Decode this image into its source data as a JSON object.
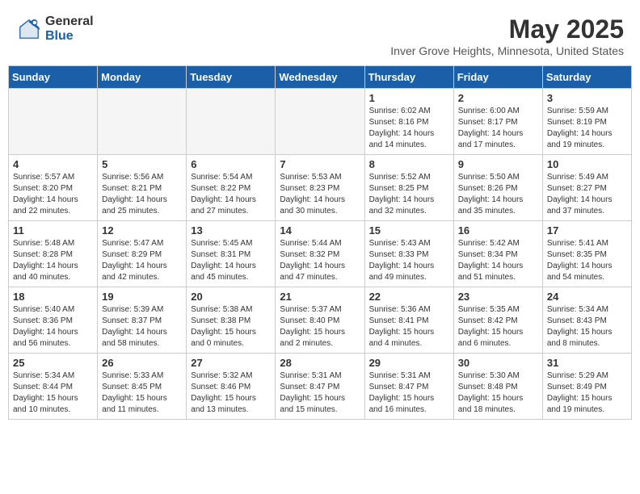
{
  "logo": {
    "general": "General",
    "blue": "Blue"
  },
  "header": {
    "title": "May 2025",
    "subtitle": "Inver Grove Heights, Minnesota, United States"
  },
  "weekdays": [
    "Sunday",
    "Monday",
    "Tuesday",
    "Wednesday",
    "Thursday",
    "Friday",
    "Saturday"
  ],
  "weeks": [
    [
      {
        "day": "",
        "empty": true
      },
      {
        "day": "",
        "empty": true
      },
      {
        "day": "",
        "empty": true
      },
      {
        "day": "",
        "empty": true
      },
      {
        "day": "1",
        "info": "Sunrise: 6:02 AM\nSunset: 8:16 PM\nDaylight: 14 hours\nand 14 minutes."
      },
      {
        "day": "2",
        "info": "Sunrise: 6:00 AM\nSunset: 8:17 PM\nDaylight: 14 hours\nand 17 minutes."
      },
      {
        "day": "3",
        "info": "Sunrise: 5:59 AM\nSunset: 8:19 PM\nDaylight: 14 hours\nand 19 minutes."
      }
    ],
    [
      {
        "day": "4",
        "info": "Sunrise: 5:57 AM\nSunset: 8:20 PM\nDaylight: 14 hours\nand 22 minutes."
      },
      {
        "day": "5",
        "info": "Sunrise: 5:56 AM\nSunset: 8:21 PM\nDaylight: 14 hours\nand 25 minutes."
      },
      {
        "day": "6",
        "info": "Sunrise: 5:54 AM\nSunset: 8:22 PM\nDaylight: 14 hours\nand 27 minutes."
      },
      {
        "day": "7",
        "info": "Sunrise: 5:53 AM\nSunset: 8:23 PM\nDaylight: 14 hours\nand 30 minutes."
      },
      {
        "day": "8",
        "info": "Sunrise: 5:52 AM\nSunset: 8:25 PM\nDaylight: 14 hours\nand 32 minutes."
      },
      {
        "day": "9",
        "info": "Sunrise: 5:50 AM\nSunset: 8:26 PM\nDaylight: 14 hours\nand 35 minutes."
      },
      {
        "day": "10",
        "info": "Sunrise: 5:49 AM\nSunset: 8:27 PM\nDaylight: 14 hours\nand 37 minutes."
      }
    ],
    [
      {
        "day": "11",
        "info": "Sunrise: 5:48 AM\nSunset: 8:28 PM\nDaylight: 14 hours\nand 40 minutes."
      },
      {
        "day": "12",
        "info": "Sunrise: 5:47 AM\nSunset: 8:29 PM\nDaylight: 14 hours\nand 42 minutes."
      },
      {
        "day": "13",
        "info": "Sunrise: 5:45 AM\nSunset: 8:31 PM\nDaylight: 14 hours\nand 45 minutes."
      },
      {
        "day": "14",
        "info": "Sunrise: 5:44 AM\nSunset: 8:32 PM\nDaylight: 14 hours\nand 47 minutes."
      },
      {
        "day": "15",
        "info": "Sunrise: 5:43 AM\nSunset: 8:33 PM\nDaylight: 14 hours\nand 49 minutes."
      },
      {
        "day": "16",
        "info": "Sunrise: 5:42 AM\nSunset: 8:34 PM\nDaylight: 14 hours\nand 51 minutes."
      },
      {
        "day": "17",
        "info": "Sunrise: 5:41 AM\nSunset: 8:35 PM\nDaylight: 14 hours\nand 54 minutes."
      }
    ],
    [
      {
        "day": "18",
        "info": "Sunrise: 5:40 AM\nSunset: 8:36 PM\nDaylight: 14 hours\nand 56 minutes."
      },
      {
        "day": "19",
        "info": "Sunrise: 5:39 AM\nSunset: 8:37 PM\nDaylight: 14 hours\nand 58 minutes."
      },
      {
        "day": "20",
        "info": "Sunrise: 5:38 AM\nSunset: 8:38 PM\nDaylight: 15 hours\nand 0 minutes."
      },
      {
        "day": "21",
        "info": "Sunrise: 5:37 AM\nSunset: 8:40 PM\nDaylight: 15 hours\nand 2 minutes."
      },
      {
        "day": "22",
        "info": "Sunrise: 5:36 AM\nSunset: 8:41 PM\nDaylight: 15 hours\nand 4 minutes."
      },
      {
        "day": "23",
        "info": "Sunrise: 5:35 AM\nSunset: 8:42 PM\nDaylight: 15 hours\nand 6 minutes."
      },
      {
        "day": "24",
        "info": "Sunrise: 5:34 AM\nSunset: 8:43 PM\nDaylight: 15 hours\nand 8 minutes."
      }
    ],
    [
      {
        "day": "25",
        "info": "Sunrise: 5:34 AM\nSunset: 8:44 PM\nDaylight: 15 hours\nand 10 minutes."
      },
      {
        "day": "26",
        "info": "Sunrise: 5:33 AM\nSunset: 8:45 PM\nDaylight: 15 hours\nand 11 minutes."
      },
      {
        "day": "27",
        "info": "Sunrise: 5:32 AM\nSunset: 8:46 PM\nDaylight: 15 hours\nand 13 minutes."
      },
      {
        "day": "28",
        "info": "Sunrise: 5:31 AM\nSunset: 8:47 PM\nDaylight: 15 hours\nand 15 minutes."
      },
      {
        "day": "29",
        "info": "Sunrise: 5:31 AM\nSunset: 8:47 PM\nDaylight: 15 hours\nand 16 minutes."
      },
      {
        "day": "30",
        "info": "Sunrise: 5:30 AM\nSunset: 8:48 PM\nDaylight: 15 hours\nand 18 minutes."
      },
      {
        "day": "31",
        "info": "Sunrise: 5:29 AM\nSunset: 8:49 PM\nDaylight: 15 hours\nand 19 minutes."
      }
    ]
  ]
}
